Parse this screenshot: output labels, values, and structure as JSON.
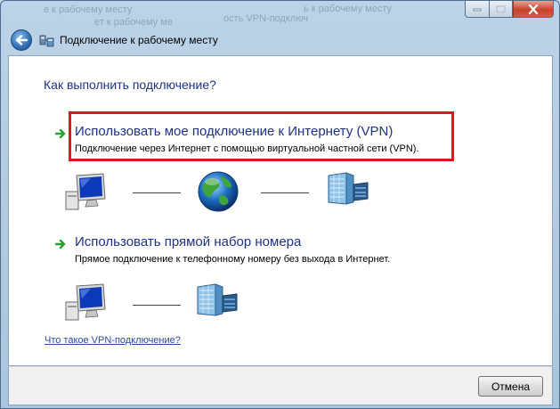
{
  "window": {
    "background_text": [
      "е к рабочему месту",
      "ость VPN-подключ",
      "ь к рабочему месту",
      "ет к рабочему ме"
    ],
    "nav_title": "Подключение к рабочему месту"
  },
  "page": {
    "heading": "Как выполнить подключение?",
    "options": [
      {
        "title": "Использовать мое подключение к Интернету (VPN)",
        "description": "Подключение через Интернет с помощью виртуальной частной сети (VPN)."
      },
      {
        "title": "Использовать прямой набор номера",
        "description": "Прямое подключение к телефонному номеру без выхода в Интернет."
      }
    ],
    "help_link": "Что такое VPN-подключение?"
  },
  "footer": {
    "cancel_label": "Отмена"
  },
  "colors": {
    "accent_text": "#1e3287",
    "highlight": "#e8141b",
    "arrow": "#2aa12e",
    "link": "#2a49a8"
  },
  "icons": {
    "back": "back-arrow-icon",
    "network": "network-connection-icon",
    "option_arrow": "green-arrow-icon",
    "computer": "computer-icon",
    "globe": "globe-icon",
    "server": "server-icon"
  }
}
